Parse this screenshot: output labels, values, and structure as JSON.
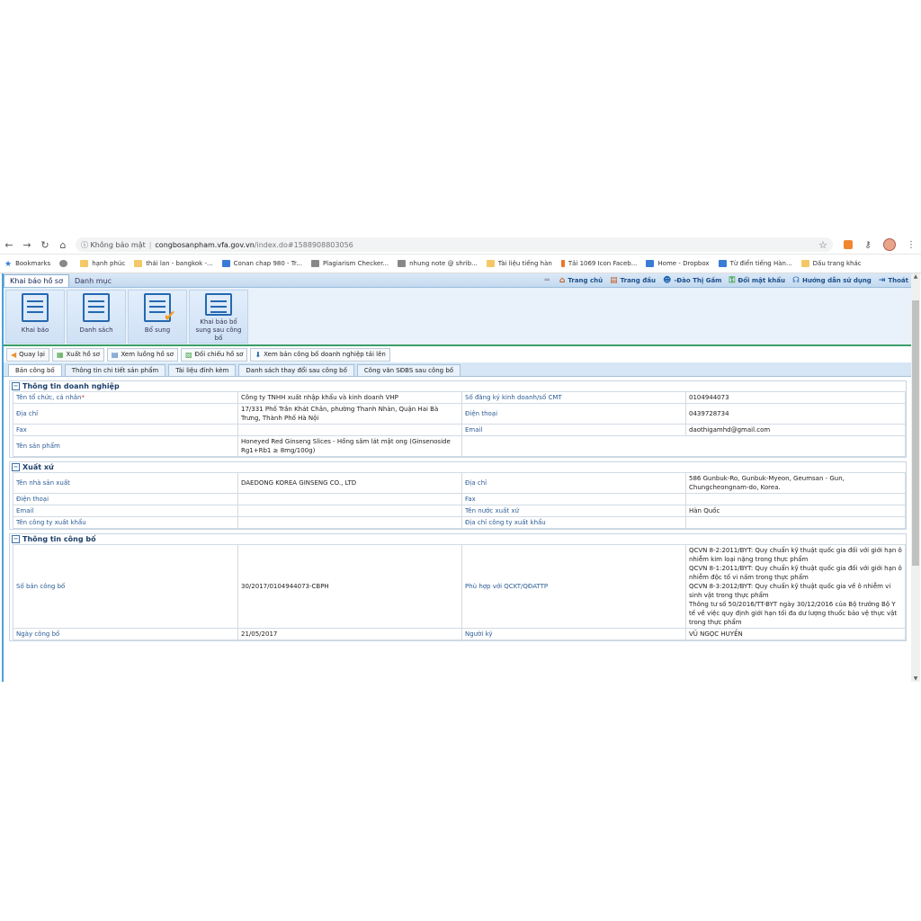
{
  "browser": {
    "url_security": "Không bảo mật",
    "url_host": "congbosanpham.vfa.gov.vn",
    "url_path": "/index.do#1588908803056",
    "bookmarks": [
      "Bookmarks",
      "hạnh phúc",
      "thái lan - bangkok -...",
      "Conan chap 980 - Tr...",
      "Plagiarism Checker...",
      "nhung note @ shrib...",
      "Tài liệu tiếng hàn",
      "Tải 1069 Icon Faceb...",
      "Home - Dropbox",
      "Từ điển tiếng Hàn...",
      "Dấu trang khác"
    ]
  },
  "app": {
    "main_tabs": [
      "Khai báo hồ sơ",
      "Danh mục"
    ],
    "top_links": [
      "Trang chủ",
      "Trang đầu",
      "-Đào Thị Gấm",
      "Đổi mật khẩu",
      "Hướng dẫn sử dụng",
      "Thoát"
    ],
    "ribbon": [
      "Khai báo",
      "Danh sách",
      "Bổ sung",
      "Khai báo bổ sung sau công bố"
    ],
    "actions": [
      "Quay lại",
      "Xuất hồ sơ",
      "Xem luồng hồ sơ",
      "Đối chiếu hồ sơ",
      "Xem bản công bố doanh nghiệp tải lên"
    ],
    "sub_tabs": [
      "Bản công bố",
      "Thông tin chi tiết sản phẩm",
      "Tài liệu đính kèm",
      "Danh sách thay đổi sau công bố",
      "Công văn SĐBS sau công bố"
    ]
  },
  "sections": {
    "doanh_nghiep": {
      "title": "Thông tin doanh nghiệp",
      "ten_to_chuc_label": "Tên tổ chức, cá nhân",
      "ten_to_chuc": "Công ty TNHH xuất nhập khẩu và kinh doanh VHP",
      "so_dk_label": "Số đăng ký kinh doanh/số CMT",
      "so_dk": "0104944073",
      "dia_chi_label": "Địa chỉ",
      "dia_chi": "17/331 Phố Trần Khát Chân, phường Thanh Nhàn, Quận Hai Bà Trưng, Thành Phố Hà Nội",
      "dien_thoai_label": "Điện thoại",
      "dien_thoai": "0439728734",
      "fax_label": "Fax",
      "email_label": "Email",
      "email": "daothigamhd@gmail.com",
      "ten_sp_label": "Tên sản phẩm",
      "ten_sp": "Honeyed Red Ginseng Slices - Hồng sâm lát mật ong (Ginsenoside Rg1+Rb1 ≥ 8mg/100g)"
    },
    "xuat_xu": {
      "title": "Xuất xứ",
      "nha_sx_label": "Tên nhà sản xuất",
      "nha_sx": "DAEDONG KOREA GINSENG CO., LTD",
      "dia_chi_label": "Địa chỉ",
      "dia_chi": "586 Gunbuk-Ro, Gunbuk-Myeon, Geumsan - Gun, Chungcheongnam-do, Korea.",
      "dien_thoai_label": "Điện thoại",
      "fax_label": "Fax",
      "email_label": "Email",
      "nuoc_xk_label": "Tên nước xuất xứ",
      "nuoc_xk": "Hàn Quốc",
      "cty_xk_label": "Tên công ty xuất khẩu",
      "dc_cty_xk_label": "Địa chỉ công ty xuất khẩu"
    },
    "cong_bo": {
      "title": "Thông tin công bố",
      "so_ban_label": "Số bản công bố",
      "so_ban": "30/2017/0104944073-CBPH",
      "phu_hop_label": "Phù hợp với QCKT/QĐATTP",
      "phu_hop": [
        "QCVN 8-2:2011/BYT: Quy chuẩn kỹ thuật quốc gia đối với giới hạn ô nhiễm kim loại nặng trong thực phẩm",
        "QCVN 8-1:2011/BYT: Quy chuẩn kỹ thuật quốc gia đối với giới hạn ô nhiễm độc tố vi nấm trong thực phẩm",
        "QCVN 8-3:2012/BYT: Quy chuẩn kỹ thuật quốc gia về ô nhiễm vi sinh vật trong thực phẩm",
        "Thông tư số 50/2016/TT-BYT ngày 30/12/2016 của Bộ trưởng Bộ Y tế về việc quy định giới hạn tối đa dư lượng thuốc bảo vệ thực vật trong thực phẩm"
      ],
      "ngay_label": "Ngày công bố",
      "ngay": "21/05/2017",
      "nguoi_ky_label": "Người ký",
      "nguoi_ky": "VŨ NGỌC HUYỀN"
    }
  }
}
